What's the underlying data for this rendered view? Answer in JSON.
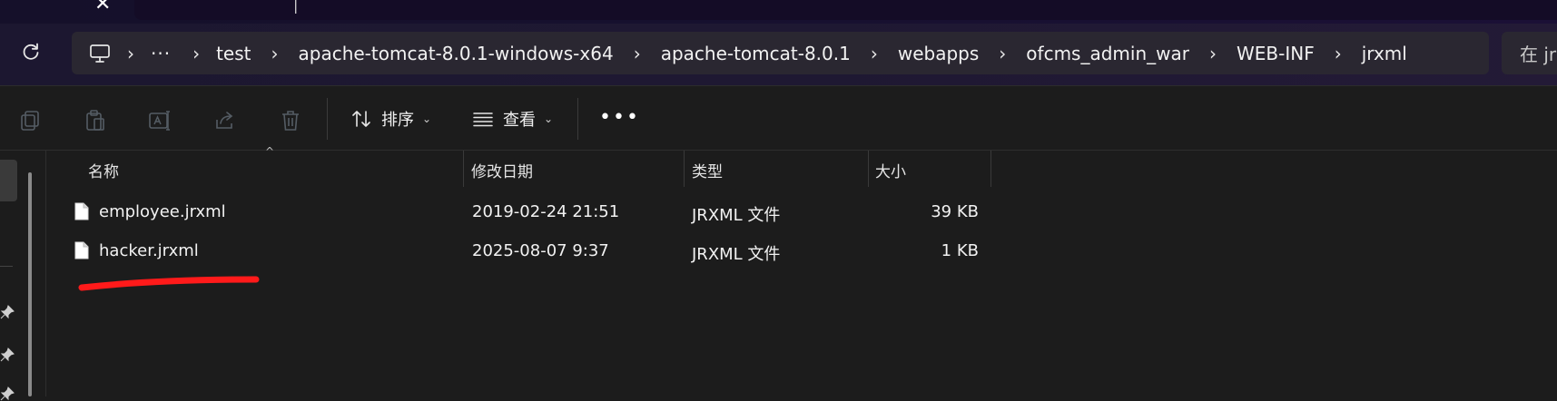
{
  "tab": {
    "close_glyph": "✕",
    "active_caret": "|"
  },
  "breadcrumb": {
    "overflow": "···",
    "items": [
      "test",
      "apache-tomcat-8.0.1-windows-x64",
      "apache-tomcat-8.0.1",
      "webapps",
      "ofcms_admin_war",
      "WEB-INF",
      "jrxml"
    ]
  },
  "search": {
    "placeholder": "在 jr"
  },
  "toolbar": {
    "sort_label": "排序",
    "view_label": "查看",
    "more_label": "•••",
    "chevron": "⌄"
  },
  "columns": {
    "name": "名称",
    "modified": "修改日期",
    "type": "类型",
    "size": "大小"
  },
  "files": [
    {
      "name": "employee.jrxml",
      "modified": "2019-02-24 21:51",
      "type": "JRXML 文件",
      "size": "39 KB"
    },
    {
      "name": "hacker.jrxml",
      "modified": "2025-08-07 9:37",
      "type": "JRXML 文件",
      "size": "1 KB"
    }
  ],
  "colors": {
    "annotation": "#ff1a1a",
    "background": "#1c1c1c",
    "addressbar": "#2a2731"
  },
  "icons": [
    "refresh-icon",
    "monitor-icon",
    "copy-icon",
    "paste-icon",
    "rename-icon",
    "share-icon",
    "delete-icon",
    "sort-icon",
    "view-icon",
    "file-icon",
    "pin-icon"
  ]
}
